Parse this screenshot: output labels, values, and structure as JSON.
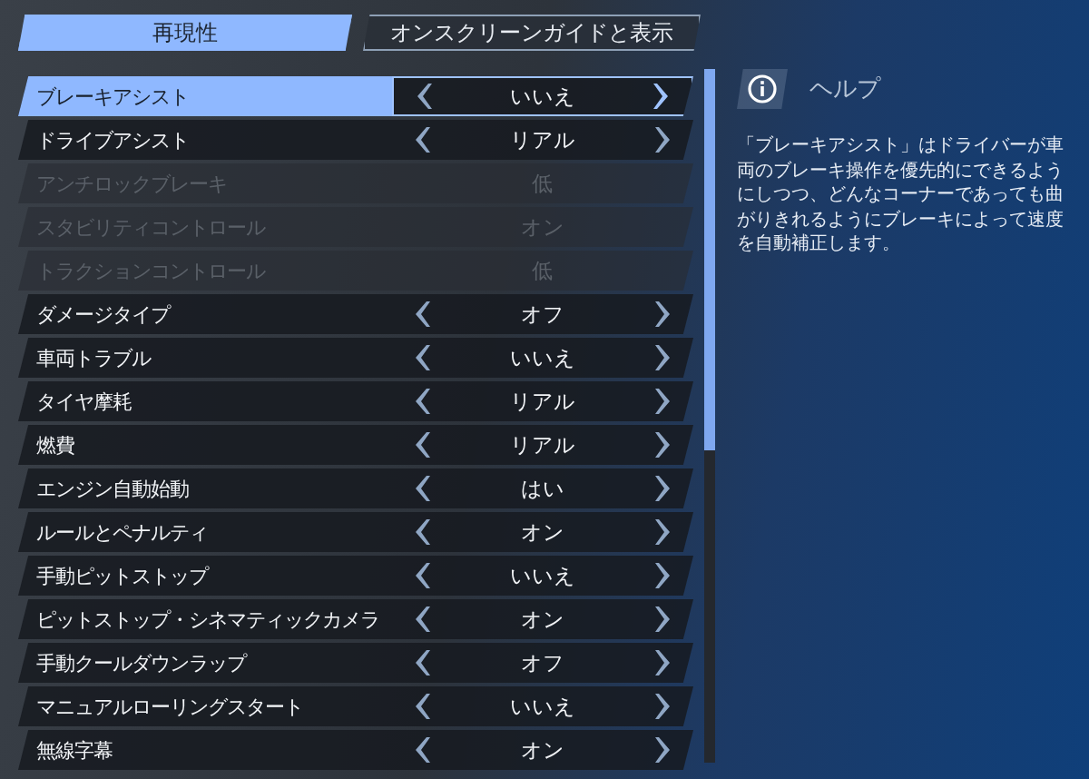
{
  "tabs": [
    {
      "label": "再現性",
      "selected": true
    },
    {
      "label": "オンスクリーンガイドと表示",
      "selected": false
    }
  ],
  "settings": [
    {
      "label": "ブレーキアシスト",
      "value": "いいえ",
      "selected": true,
      "disabled": false
    },
    {
      "label": "ドライブアシスト",
      "value": "リアル",
      "selected": false,
      "disabled": false
    },
    {
      "label": "アンチロックブレーキ",
      "value": "低",
      "selected": false,
      "disabled": true
    },
    {
      "label": "スタビリティコントロール",
      "value": "オン",
      "selected": false,
      "disabled": true
    },
    {
      "label": "トラクションコントロール",
      "value": "低",
      "selected": false,
      "disabled": true
    },
    {
      "label": "ダメージタイプ",
      "value": "オフ",
      "selected": false,
      "disabled": false
    },
    {
      "label": "車両トラブル",
      "value": "いいえ",
      "selected": false,
      "disabled": false
    },
    {
      "label": "タイヤ摩耗",
      "value": "リアル",
      "selected": false,
      "disabled": false
    },
    {
      "label": "燃費",
      "value": "リアル",
      "selected": false,
      "disabled": false
    },
    {
      "label": "エンジン自動始動",
      "value": "はい",
      "selected": false,
      "disabled": false
    },
    {
      "label": "ルールとペナルティ",
      "value": "オン",
      "selected": false,
      "disabled": false
    },
    {
      "label": "手動ピットストップ",
      "value": "いいえ",
      "selected": false,
      "disabled": false
    },
    {
      "label": "ピットストップ・シネマティックカメラ",
      "value": "オン",
      "selected": false,
      "disabled": false
    },
    {
      "label": "手動クールダウンラップ",
      "value": "オフ",
      "selected": false,
      "disabled": false
    },
    {
      "label": "マニュアルローリングスタート",
      "value": "いいえ",
      "selected": false,
      "disabled": false
    },
    {
      "label": "無線字幕",
      "value": "オン",
      "selected": false,
      "disabled": false
    }
  ],
  "help": {
    "title": "ヘルプ",
    "text": "「ブレーキアシスト」はドライバーが車両のブレーキ操作を優先的にできるようにしつつ、どんなコーナーであっても曲がりきれるようにブレーキによって速度を自動補正します。"
  }
}
